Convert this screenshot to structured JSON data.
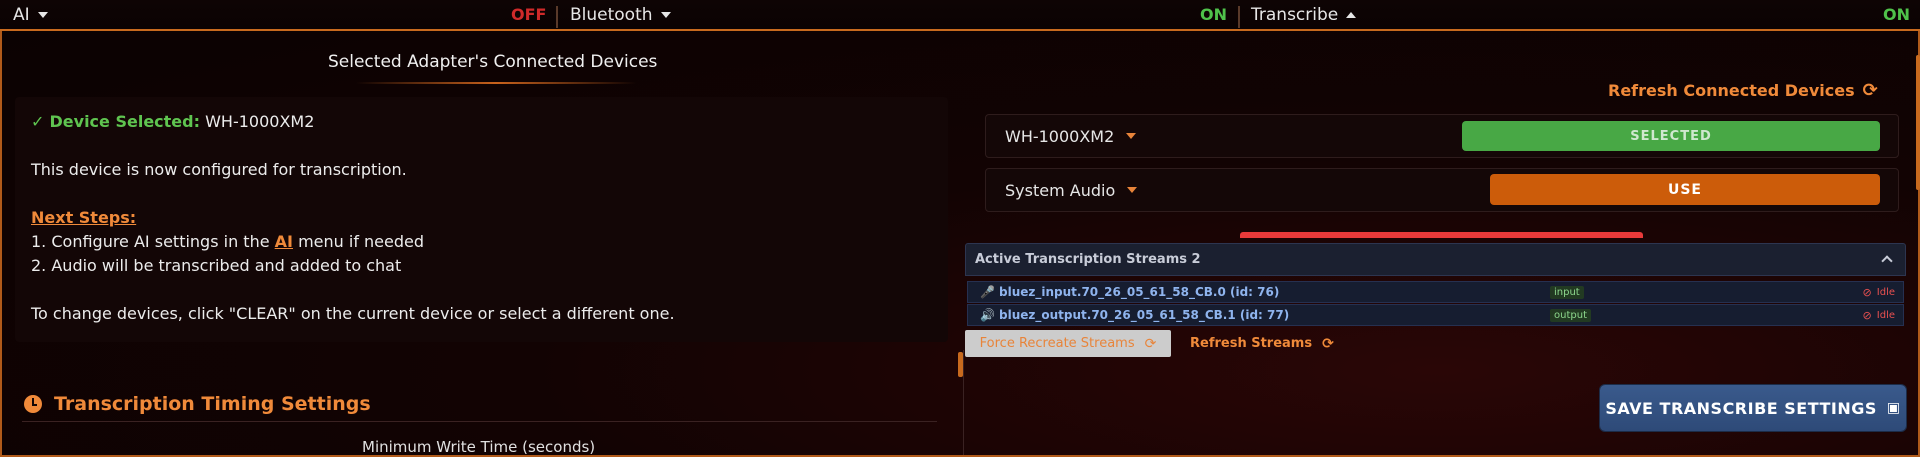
{
  "topbar": {
    "ai": {
      "label": "AI",
      "state": "OFF"
    },
    "bluetooth": {
      "label": "Bluetooth",
      "state": "ON"
    },
    "transcribe": {
      "label": "Transcribe",
      "state": "ON"
    }
  },
  "left_panel": {
    "title": "Selected Adapter's Connected Devices",
    "device_selected_check": "✓",
    "device_selected_label": "Device Selected:",
    "device_selected_value": "WH-1000XM2",
    "configured_text": "This device is now configured for transcription.",
    "next_steps_label": "Next Steps:",
    "step1_prefix": "1. Configure AI settings in the ",
    "step1_link": "AI",
    "step1_suffix": " menu if needed",
    "step2": "2. Audio will be transcribed and added to chat",
    "change_devices": "To change devices, click \"CLEAR\" on the current device or select a different one.",
    "timing_title": "Transcription Timing Settings",
    "min_write_label": "Minimum Write Time (seconds)"
  },
  "right_panel": {
    "refresh_devices_label": "Refresh Connected Devices",
    "devices": [
      {
        "name": "WH-1000XM2",
        "button": "SELECTED"
      },
      {
        "name": "System Audio",
        "button": "USE"
      }
    ],
    "streams_title": "Active Transcription Streams 2",
    "streams": [
      {
        "icon": "🎤",
        "name": "bluez_input.70_26_05_61_58_CB.0 (id: 76)",
        "tag": "input",
        "status": "Idle"
      },
      {
        "icon": "🔊",
        "name": "bluez_output.70_26_05_61_58_CB.1 (id: 77)",
        "tag": "output",
        "status": "Idle"
      }
    ],
    "force_recreate_label": "Force Recreate Streams",
    "refresh_streams_label": "Refresh Streams",
    "save_label": "SAVE TRANSCRIBE SETTINGS"
  },
  "colors": {
    "accent": "#f08a3a",
    "off": "#d02a2a",
    "on": "#4fc24a",
    "selected_button": "#48a845",
    "use_button": "#cc5c0a",
    "save_button": "#3a5a8c"
  }
}
